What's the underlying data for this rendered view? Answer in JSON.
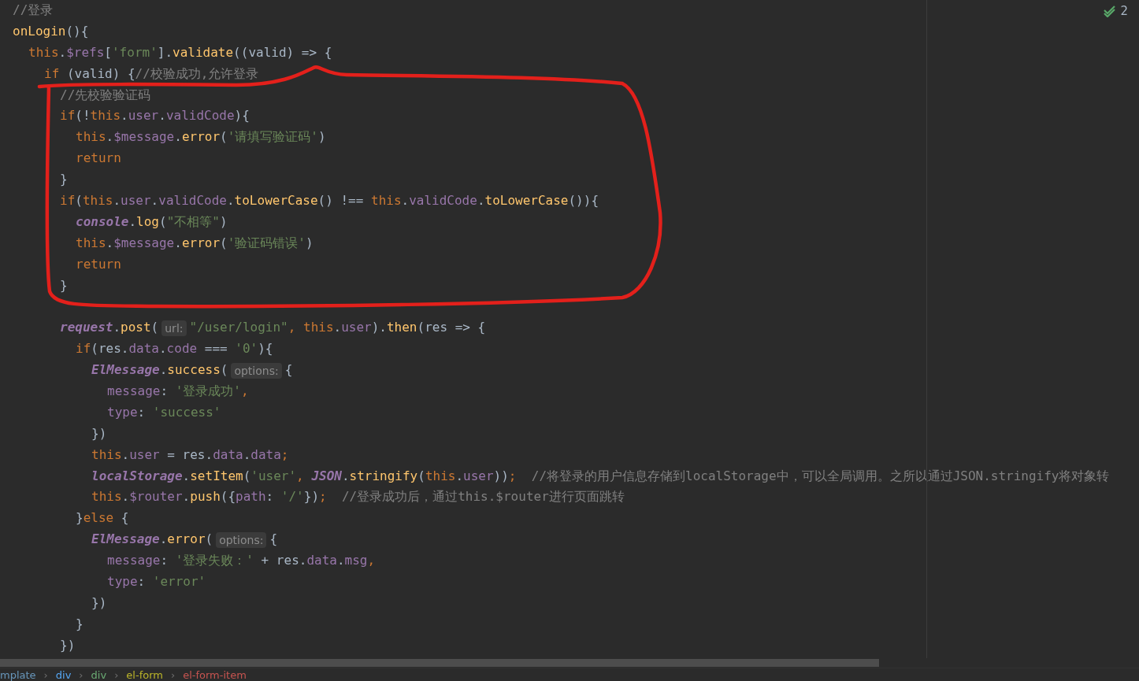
{
  "editor": {
    "lines": [
      {
        "kind": "code",
        "segments": [
          {
            "kind": "code",
            "tokens": [
              {
                "kind": "comment",
                "text": "//登录"
              }
            ]
          }
        ]
      },
      {
        "kind": "code",
        "segments": [
          {
            "kind": "code",
            "tokens": [
              {
                "kind": "fn",
                "text": "onLogin"
              },
              {
                "kind": "plain",
                "text": "(){"
              }
            ]
          }
        ],
        "children": [
          {
            "kind": "code",
            "segments": [
              {
                "kind": "code",
                "tokens": [
                  {
                    "kind": "kw",
                    "text": "this"
                  },
                  {
                    "kind": "plain",
                    "text": "."
                  },
                  {
                    "kind": "prop",
                    "text": "$refs"
                  },
                  {
                    "kind": "plain",
                    "text": "["
                  },
                  {
                    "kind": "str",
                    "text": "'form'"
                  },
                  {
                    "kind": "plain",
                    "text": "]."
                  },
                  {
                    "kind": "fn",
                    "text": "validate"
                  },
                  {
                    "kind": "plain",
                    "text": "((valid) => {"
                  }
                ]
              }
            ],
            "children": [
              {
                "kind": "code",
                "segments": [
                  {
                    "kind": "code",
                    "tokens": [
                      {
                        "kind": "kw",
                        "text": "if"
                      },
                      {
                        "kind": "plain",
                        "text": " (valid) {"
                      },
                      {
                        "kind": "comment",
                        "text": "//校验成功,允许登录"
                      }
                    ]
                  }
                ],
                "children": [
                  {
                    "kind": "code",
                    "segments": [
                      {
                        "kind": "code",
                        "tokens": [
                          {
                            "kind": "comment",
                            "text": "//先校验验证码"
                          }
                        ]
                      }
                    ]
                  },
                  {
                    "kind": "code",
                    "segments": [
                      {
                        "kind": "code",
                        "tokens": [
                          {
                            "kind": "kw",
                            "text": "if"
                          },
                          {
                            "kind": "plain",
                            "text": "(!"
                          },
                          {
                            "kind": "kw",
                            "text": "this"
                          },
                          {
                            "kind": "plain",
                            "text": "."
                          },
                          {
                            "kind": "prop",
                            "text": "user"
                          },
                          {
                            "kind": "plain",
                            "text": "."
                          },
                          {
                            "kind": "prop",
                            "text": "validCode"
                          },
                          {
                            "kind": "plain",
                            "text": "){"
                          }
                        ]
                      }
                    ],
                    "children": [
                      {
                        "kind": "code",
                        "segments": [
                          {
                            "kind": "code",
                            "tokens": [
                              {
                                "kind": "kw",
                                "text": "this"
                              },
                              {
                                "kind": "plain",
                                "text": "."
                              },
                              {
                                "kind": "prop",
                                "text": "$message"
                              },
                              {
                                "kind": "plain",
                                "text": "."
                              },
                              {
                                "kind": "fn",
                                "text": "error"
                              },
                              {
                                "kind": "plain",
                                "text": "("
                              },
                              {
                                "kind": "str",
                                "text": "'请填写验证码'"
                              },
                              {
                                "kind": "plain",
                                "text": ")"
                              }
                            ]
                          }
                        ]
                      },
                      {
                        "kind": "code",
                        "segments": [
                          {
                            "kind": "code",
                            "tokens": [
                              {
                                "kind": "kw",
                                "text": "return"
                              }
                            ]
                          }
                        ]
                      }
                    ]
                  },
                  {
                    "kind": "code",
                    "segments": [
                      {
                        "kind": "code",
                        "tokens": [
                          {
                            "kind": "plain",
                            "text": "}"
                          }
                        ]
                      }
                    ]
                  },
                  {
                    "kind": "code",
                    "segments": [
                      {
                        "kind": "code",
                        "tokens": [
                          {
                            "kind": "kw",
                            "text": "if"
                          },
                          {
                            "kind": "plain",
                            "text": "("
                          },
                          {
                            "kind": "kw",
                            "text": "this"
                          },
                          {
                            "kind": "plain",
                            "text": "."
                          },
                          {
                            "kind": "prop",
                            "text": "user"
                          },
                          {
                            "kind": "plain",
                            "text": "."
                          },
                          {
                            "kind": "prop",
                            "text": "validCode"
                          },
                          {
                            "kind": "plain",
                            "text": "."
                          },
                          {
                            "kind": "fn",
                            "text": "toLowerCase"
                          },
                          {
                            "kind": "plain",
                            "text": "() !== "
                          },
                          {
                            "kind": "kw",
                            "text": "this"
                          },
                          {
                            "kind": "plain",
                            "text": "."
                          },
                          {
                            "kind": "prop",
                            "text": "validCode"
                          },
                          {
                            "kind": "plain",
                            "text": "."
                          },
                          {
                            "kind": "fn",
                            "text": "toLowerCase"
                          },
                          {
                            "kind": "plain",
                            "text": "()){"
                          }
                        ]
                      }
                    ],
                    "children": [
                      {
                        "kind": "code",
                        "segments": [
                          {
                            "kind": "code",
                            "tokens": [
                              {
                                "kind": "global",
                                "text": "console"
                              },
                              {
                                "kind": "plain",
                                "text": "."
                              },
                              {
                                "kind": "fn",
                                "text": "log"
                              },
                              {
                                "kind": "plain",
                                "text": "("
                              },
                              {
                                "kind": "str",
                                "text": "\"不相等\""
                              },
                              {
                                "kind": "plain",
                                "text": ")"
                              }
                            ]
                          }
                        ]
                      },
                      {
                        "kind": "code",
                        "segments": [
                          {
                            "kind": "code",
                            "tokens": [
                              {
                                "kind": "kw",
                                "text": "this"
                              },
                              {
                                "kind": "plain",
                                "text": "."
                              },
                              {
                                "kind": "prop",
                                "text": "$message"
                              },
                              {
                                "kind": "plain",
                                "text": "."
                              },
                              {
                                "kind": "fn",
                                "text": "error"
                              },
                              {
                                "kind": "plain",
                                "text": "("
                              },
                              {
                                "kind": "str",
                                "text": "'验证码错误'"
                              },
                              {
                                "kind": "plain",
                                "text": ")"
                              }
                            ]
                          }
                        ]
                      },
                      {
                        "kind": "code",
                        "segments": [
                          {
                            "kind": "code",
                            "tokens": [
                              {
                                "kind": "kw",
                                "text": "return"
                              }
                            ]
                          }
                        ]
                      }
                    ]
                  },
                  {
                    "kind": "code",
                    "segments": [
                      {
                        "kind": "code",
                        "tokens": [
                          {
                            "kind": "plain",
                            "text": "}"
                          }
                        ]
                      }
                    ]
                  },
                  {
                    "kind": "blank"
                  },
                  {
                    "kind": "code",
                    "segments": [
                      {
                        "kind": "code",
                        "tokens": [
                          {
                            "kind": "global",
                            "text": "request"
                          },
                          {
                            "kind": "plain",
                            "text": "."
                          },
                          {
                            "kind": "fn",
                            "text": "post"
                          },
                          {
                            "kind": "plain",
                            "text": "("
                          }
                        ]
                      },
                      {
                        "kind": "hint",
                        "text": "url:"
                      },
                      {
                        "kind": "code",
                        "tokens": [
                          {
                            "kind": "str",
                            "text": "\"/user/login\""
                          },
                          {
                            "kind": "kw",
                            "text": ", this"
                          },
                          {
                            "kind": "plain",
                            "text": "."
                          },
                          {
                            "kind": "prop",
                            "text": "user"
                          },
                          {
                            "kind": "plain",
                            "text": ")."
                          },
                          {
                            "kind": "fn",
                            "text": "then"
                          },
                          {
                            "kind": "plain",
                            "text": "(res => {"
                          }
                        ]
                      }
                    ],
                    "children": [
                      {
                        "kind": "code",
                        "segments": [
                          {
                            "kind": "code",
                            "tokens": [
                              {
                                "kind": "kw",
                                "text": "if"
                              },
                              {
                                "kind": "plain",
                                "text": "(res."
                              },
                              {
                                "kind": "prop",
                                "text": "data"
                              },
                              {
                                "kind": "plain",
                                "text": "."
                              },
                              {
                                "kind": "prop",
                                "text": "code"
                              },
                              {
                                "kind": "plain",
                                "text": " === "
                              },
                              {
                                "kind": "str",
                                "text": "'0'"
                              },
                              {
                                "kind": "plain",
                                "text": "){"
                              }
                            ]
                          }
                        ],
                        "children": [
                          {
                            "kind": "code",
                            "segments": [
                              {
                                "kind": "code",
                                "tokens": [
                                  {
                                    "kind": "global",
                                    "text": "ElMessage"
                                  },
                                  {
                                    "kind": "plain",
                                    "text": "."
                                  },
                                  {
                                    "kind": "fn",
                                    "text": "success"
                                  },
                                  {
                                    "kind": "plain",
                                    "text": "("
                                  }
                                ]
                              },
                              {
                                "kind": "hint",
                                "text": "options:"
                              },
                              {
                                "kind": "code",
                                "tokens": [
                                  {
                                    "kind": "plain",
                                    "text": "{"
                                  }
                                ]
                              }
                            ],
                            "children": [
                              {
                                "kind": "code",
                                "segments": [
                                  {
                                    "kind": "code",
                                    "tokens": [
                                      {
                                        "kind": "prop",
                                        "text": "message"
                                      },
                                      {
                                        "kind": "plain",
                                        "text": ": "
                                      },
                                      {
                                        "kind": "str",
                                        "text": "'登录成功'"
                                      },
                                      {
                                        "kind": "kw",
                                        "text": ","
                                      }
                                    ]
                                  }
                                ]
                              },
                              {
                                "kind": "code",
                                "segments": [
                                  {
                                    "kind": "code",
                                    "tokens": [
                                      {
                                        "kind": "prop",
                                        "text": "type"
                                      },
                                      {
                                        "kind": "plain",
                                        "text": ": "
                                      },
                                      {
                                        "kind": "str",
                                        "text": "'success'"
                                      }
                                    ]
                                  }
                                ]
                              }
                            ]
                          },
                          {
                            "kind": "code",
                            "segments": [
                              {
                                "kind": "code",
                                "tokens": [
                                  {
                                    "kind": "plain",
                                    "text": "})"
                                  }
                                ]
                              }
                            ]
                          },
                          {
                            "kind": "code",
                            "segments": [
                              {
                                "kind": "code",
                                "tokens": [
                                  {
                                    "kind": "kw",
                                    "text": "this"
                                  },
                                  {
                                    "kind": "plain",
                                    "text": "."
                                  },
                                  {
                                    "kind": "prop",
                                    "text": "user"
                                  },
                                  {
                                    "kind": "plain",
                                    "text": " = res."
                                  },
                                  {
                                    "kind": "prop",
                                    "text": "data"
                                  },
                                  {
                                    "kind": "plain",
                                    "text": "."
                                  },
                                  {
                                    "kind": "prop",
                                    "text": "data"
                                  },
                                  {
                                    "kind": "kw",
                                    "text": ";"
                                  }
                                ]
                              }
                            ]
                          },
                          {
                            "kind": "code",
                            "segments": [
                              {
                                "kind": "code",
                                "tokens": [
                                  {
                                    "kind": "global",
                                    "text": "localStorage"
                                  },
                                  {
                                    "kind": "plain",
                                    "text": "."
                                  },
                                  {
                                    "kind": "fn",
                                    "text": "setItem"
                                  },
                                  {
                                    "kind": "plain",
                                    "text": "("
                                  },
                                  {
                                    "kind": "str",
                                    "text": "'user'"
                                  },
                                  {
                                    "kind": "kw",
                                    "text": ", "
                                  },
                                  {
                                    "kind": "global",
                                    "text": "JSON"
                                  },
                                  {
                                    "kind": "plain",
                                    "text": "."
                                  },
                                  {
                                    "kind": "fn",
                                    "text": "stringify"
                                  },
                                  {
                                    "kind": "plain",
                                    "text": "("
                                  },
                                  {
                                    "kind": "kw",
                                    "text": "this"
                                  },
                                  {
                                    "kind": "plain",
                                    "text": "."
                                  },
                                  {
                                    "kind": "prop",
                                    "text": "user"
                                  },
                                  {
                                    "kind": "plain",
                                    "text": "))"
                                  },
                                  {
                                    "kind": "kw",
                                    "text": ";  "
                                  },
                                  {
                                    "kind": "comment",
                                    "text": "//将登录的用户信息存储到localStorage中，可以全局调用。之所以通过JSON.stringify将对象转"
                                  }
                                ]
                              }
                            ]
                          },
                          {
                            "kind": "code",
                            "segments": [
                              {
                                "kind": "code",
                                "tokens": [
                                  {
                                    "kind": "kw",
                                    "text": "this"
                                  },
                                  {
                                    "kind": "plain",
                                    "text": "."
                                  },
                                  {
                                    "kind": "prop",
                                    "text": "$router"
                                  },
                                  {
                                    "kind": "plain",
                                    "text": "."
                                  },
                                  {
                                    "kind": "fn",
                                    "text": "push"
                                  },
                                  {
                                    "kind": "plain",
                                    "text": "({"
                                  },
                                  {
                                    "kind": "prop",
                                    "text": "path"
                                  },
                                  {
                                    "kind": "plain",
                                    "text": ": "
                                  },
                                  {
                                    "kind": "str",
                                    "text": "'/'"
                                  },
                                  {
                                    "kind": "plain",
                                    "text": "})"
                                  },
                                  {
                                    "kind": "kw",
                                    "text": ";  "
                                  },
                                  {
                                    "kind": "comment",
                                    "text": "//登录成功后，通过this.$router进行页面跳转"
                                  }
                                ]
                              }
                            ]
                          }
                        ]
                      },
                      {
                        "kind": "code",
                        "segments": [
                          {
                            "kind": "code",
                            "tokens": [
                              {
                                "kind": "plain",
                                "text": "}"
                              },
                              {
                                "kind": "kw",
                                "text": "else"
                              },
                              {
                                "kind": "plain",
                                "text": " {"
                              }
                            ]
                          }
                        ],
                        "children": [
                          {
                            "kind": "code",
                            "segments": [
                              {
                                "kind": "code",
                                "tokens": [
                                  {
                                    "kind": "global",
                                    "text": "ElMessage"
                                  },
                                  {
                                    "kind": "plain",
                                    "text": "."
                                  },
                                  {
                                    "kind": "fn",
                                    "text": "error"
                                  },
                                  {
                                    "kind": "plain",
                                    "text": "("
                                  }
                                ]
                              },
                              {
                                "kind": "hint",
                                "text": "options:"
                              },
                              {
                                "kind": "code",
                                "tokens": [
                                  {
                                    "kind": "plain",
                                    "text": "{"
                                  }
                                ]
                              }
                            ],
                            "children": [
                              {
                                "kind": "code",
                                "segments": [
                                  {
                                    "kind": "code",
                                    "tokens": [
                                      {
                                        "kind": "prop",
                                        "text": "message"
                                      },
                                      {
                                        "kind": "plain",
                                        "text": ": "
                                      },
                                      {
                                        "kind": "str",
                                        "text": "'登录失败：'"
                                      },
                                      {
                                        "kind": "plain",
                                        "text": " + res."
                                      },
                                      {
                                        "kind": "prop",
                                        "text": "data"
                                      },
                                      {
                                        "kind": "plain",
                                        "text": "."
                                      },
                                      {
                                        "kind": "prop",
                                        "text": "msg"
                                      },
                                      {
                                        "kind": "kw",
                                        "text": ","
                                      }
                                    ]
                                  }
                                ]
                              },
                              {
                                "kind": "code",
                                "segments": [
                                  {
                                    "kind": "code",
                                    "tokens": [
                                      {
                                        "kind": "prop",
                                        "text": "type"
                                      },
                                      {
                                        "kind": "plain",
                                        "text": ": "
                                      },
                                      {
                                        "kind": "str",
                                        "text": "'error'"
                                      }
                                    ]
                                  }
                                ]
                              }
                            ]
                          },
                          {
                            "kind": "code",
                            "segments": [
                              {
                                "kind": "code",
                                "tokens": [
                                  {
                                    "kind": "plain",
                                    "text": "})"
                                  }
                                ]
                              }
                            ]
                          }
                        ]
                      },
                      {
                        "kind": "code",
                        "segments": [
                          {
                            "kind": "code",
                            "tokens": [
                              {
                                "kind": "plain",
                                "text": "}"
                              }
                            ]
                          }
                        ]
                      }
                    ]
                  },
                  {
                    "kind": "code",
                    "segments": [
                      {
                        "kind": "code",
                        "tokens": [
                          {
                            "kind": "plain",
                            "text": "})"
                          }
                        ]
                      }
                    ]
                  }
                ]
              }
            ]
          }
        ]
      }
    ]
  },
  "inspection": {
    "count": "2"
  },
  "breadcrumb": [
    {
      "text": "mplate",
      "color": "#6897bb"
    },
    {
      "text": "div",
      "color": "#56a8f5"
    },
    {
      "text": "div",
      "color": "#6aab73"
    },
    {
      "text": "el-form",
      "color": "#bbb529"
    },
    {
      "text": "el-form-item",
      "color": "#c75450"
    }
  ],
  "breadcrumb_separator": "›"
}
